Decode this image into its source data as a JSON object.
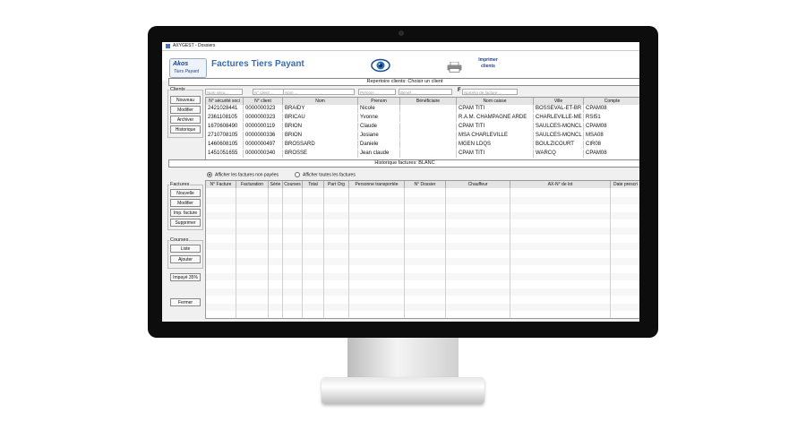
{
  "window": {
    "title": "AXYGEST - Dossiers"
  },
  "header": {
    "logo_line1": "Akos",
    "logo_line2": "Tiers Payant",
    "app_title": "Factures Tiers Payant",
    "print_label": "Imprimer clients"
  },
  "clients_section": {
    "bar_label": "Repertoire clients: Choisir un client",
    "group_label": "Clients",
    "buttons": [
      "Nouveau",
      "Modifier",
      "Archiver",
      "Historique"
    ],
    "filters": {
      "secu": "Num sécu...",
      "client": "N° client ...",
      "nom": "Nom ...",
      "prenom": "Prénom ...",
      "benef": "Bénéf. ...",
      "flag": "F",
      "facture": "Numéro de facture ..."
    },
    "columns": [
      "N° sécurité soci",
      "N° client",
      "Nom",
      "Prenom",
      "Bénéficiaire",
      "Nom caisse",
      "Ville",
      "Compte"
    ],
    "rows": [
      [
        "2421028441",
        "0000000323",
        "BRAIDY",
        "Nicole",
        "",
        "CPAM TITI",
        "BOSSEVAL-ET-BR",
        "CPAM08"
      ],
      [
        "2361108105",
        "0000000323",
        "BRICAU",
        "Yvonne",
        "",
        "R.A.M. CHAMPAGNE ARDE",
        "CHARLEVILLE-ME",
        "RSI51"
      ],
      [
        "1670608490",
        "0000000119",
        "BRION",
        "Claude",
        "",
        "CPAM TITI",
        "SAULCES-MONCL",
        "CPAM08"
      ],
      [
        "2710708105",
        "0000000336",
        "BRION",
        "Josiane",
        "",
        "MSA CHARLEVILLE",
        "SAULCES-MONCL",
        "MSA08"
      ],
      [
        "1460608105",
        "0000000497",
        "BROSSARD",
        "Daniele",
        "",
        "MGEN LDQS",
        "BOULZICOURT",
        "CIR08"
      ],
      [
        "1451051655",
        "0000000340",
        "BROSSE",
        "Jean claude",
        "",
        "CPAM TITI",
        "WARCQ",
        "CPAM08"
      ]
    ]
  },
  "factures_section": {
    "bar_label": "Historique factures: BLANC",
    "radio_unpaid": "Afficher les factures non payées",
    "radio_all": "Afficher toutes les factures",
    "group_label": "Factures",
    "buttons": [
      "Nouvelle",
      "Modifier",
      "Imp. facture",
      "Supprimer"
    ],
    "courses_label": "Courses",
    "courses_buttons": [
      "Liste",
      "Ajouter"
    ],
    "impaye": "Impayé 35%",
    "close": "Fermer",
    "columns": [
      "N° Facture",
      "Facturation",
      "Série",
      "Courses",
      "Total",
      "Part Org",
      "Personne transportée",
      "N° Dossier",
      "Chauffeur",
      "AX-N° de lot",
      "Date prescri"
    ]
  }
}
